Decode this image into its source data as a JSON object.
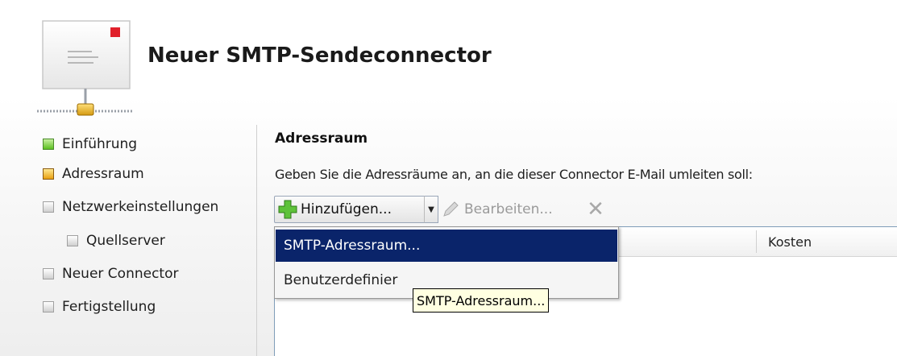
{
  "wizard": {
    "title": "Neuer SMTP-Sendeconnector"
  },
  "nav": {
    "items": [
      {
        "label": "Einführung",
        "state": "done"
      },
      {
        "label": "Adressraum",
        "state": "active"
      },
      {
        "label": "Netzwerkeinstellungen",
        "state": "pending"
      },
      {
        "label": "Quellserver",
        "state": "pending"
      },
      {
        "label": "Neuer Connector",
        "state": "pending"
      },
      {
        "label": "Fertigstellung",
        "state": "pending"
      }
    ]
  },
  "main": {
    "section_title": "Adressraum",
    "instructions": "Geben Sie die Adressräume an, an die dieser Connector E-Mail umleiten soll:",
    "toolbar": {
      "add_label": "Hinzufügen...",
      "edit_label": "Bearbeiten..."
    },
    "table": {
      "columns": [
        "Kosten"
      ]
    }
  },
  "dropdown": {
    "items": [
      {
        "label": "SMTP-Adressraum...",
        "highlighted": true
      },
      {
        "label": "Benutzerdefinier",
        "highlighted": false
      }
    ]
  },
  "tooltip": {
    "text": "SMTP-Adressraum..."
  },
  "colors": {
    "menu_highlight": "#0a246a",
    "step_done": "#5cc020",
    "step_active": "#e8a010",
    "tooltip_bg": "#ffffe1"
  }
}
